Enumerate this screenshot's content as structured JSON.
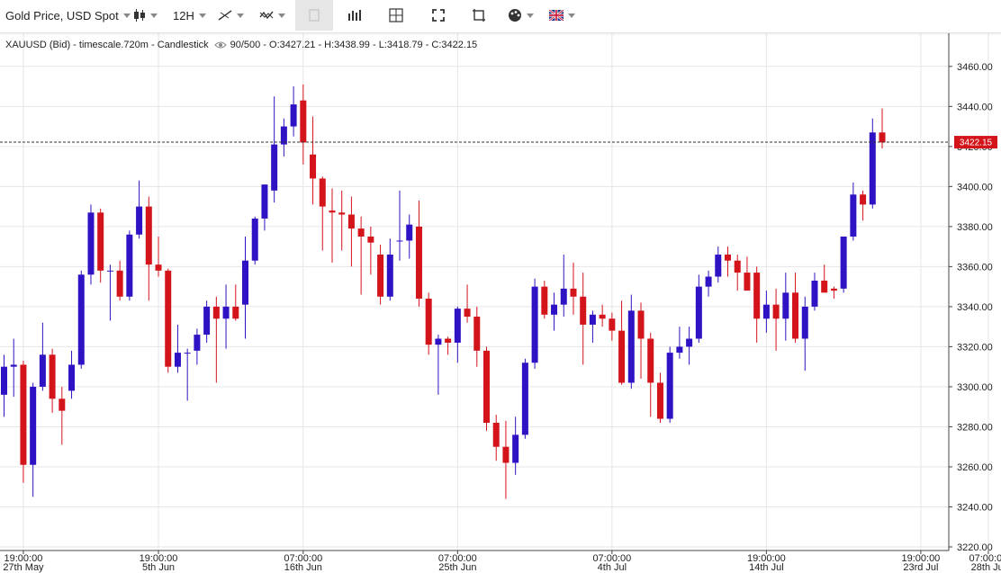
{
  "toolbar": {
    "symbol_label": "Gold Price, USD Spot",
    "timeframe_label": "12H"
  },
  "legend": {
    "series_title": "XAUUSD (Bid) - timescale.720m - Candlestick",
    "range": "90/500",
    "ohlc": "- O:3427.21 - H:3438.99 - L:3418.79 - C:3422.15"
  },
  "colors": {
    "up": "#2d13c4",
    "down": "#d4141b",
    "grid": "#e6e6e6",
    "price_tag": "#d4141b"
  },
  "chart_data": {
    "type": "candlestick",
    "ylim": [
      3220,
      3480
    ],
    "yticks": [
      3220,
      3240,
      3260,
      3280,
      3300,
      3320,
      3340,
      3360,
      3380,
      3400,
      3420,
      3440,
      3460,
      3480
    ],
    "last_price": 3422.15,
    "last_price_label": "3422.15",
    "x_ticks": [
      {
        "index": 2,
        "time": "19:00:00",
        "date": "27th May"
      },
      {
        "index": 16,
        "time": "19:00:00",
        "date": "5th Jun"
      },
      {
        "index": 31,
        "time": "07:00:00",
        "date": "16th Jun"
      },
      {
        "index": 47,
        "time": "07:00:00",
        "date": "25th Jun"
      },
      {
        "index": 63,
        "time": "07:00:00",
        "date": "4th Jul"
      },
      {
        "index": 79,
        "time": "19:00:00",
        "date": "14th Jul"
      },
      {
        "index": 95,
        "time": "19:00:00",
        "date": "23rd Jul"
      },
      {
        "index": 102,
        "time": "07:00:00",
        "date": "28th Jul"
      }
    ],
    "candles": [
      {
        "o": 3296,
        "h": 3316,
        "l": 3285,
        "c": 3310
      },
      {
        "o": 3310,
        "h": 3324,
        "l": 3295,
        "c": 3311
      },
      {
        "o": 3311,
        "h": 3313,
        "l": 3252,
        "c": 3261
      },
      {
        "o": 3261,
        "h": 3302,
        "l": 3245,
        "c": 3300
      },
      {
        "o": 3300,
        "h": 3332,
        "l": 3298,
        "c": 3316
      },
      {
        "o": 3316,
        "h": 3319,
        "l": 3287,
        "c": 3294
      },
      {
        "o": 3294,
        "h": 3300,
        "l": 3271,
        "c": 3288
      },
      {
        "o": 3298,
        "h": 3318,
        "l": 3294,
        "c": 3311
      },
      {
        "o": 3311,
        "h": 3358,
        "l": 3309,
        "c": 3356
      },
      {
        "o": 3356,
        "h": 3391,
        "l": 3351,
        "c": 3387
      },
      {
        "o": 3387,
        "h": 3389,
        "l": 3352,
        "c": 3358
      },
      {
        "o": 3358,
        "h": 3361,
        "l": 3333,
        "c": 3358
      },
      {
        "o": 3358,
        "h": 3363,
        "l": 3343,
        "c": 3345
      },
      {
        "o": 3345,
        "h": 3378,
        "l": 3343,
        "c": 3376
      },
      {
        "o": 3376,
        "h": 3403,
        "l": 3374,
        "c": 3390
      },
      {
        "o": 3390,
        "h": 3395,
        "l": 3343,
        "c": 3361
      },
      {
        "o": 3361,
        "h": 3375,
        "l": 3355,
        "c": 3358
      },
      {
        "o": 3358,
        "h": 3359,
        "l": 3307,
        "c": 3310
      },
      {
        "o": 3310,
        "h": 3331,
        "l": 3307,
        "c": 3317
      },
      {
        "o": 3317,
        "h": 3319,
        "l": 3293,
        "c": 3317
      },
      {
        "o": 3318,
        "h": 3329,
        "l": 3311,
        "c": 3326
      },
      {
        "o": 3326,
        "h": 3343,
        "l": 3322,
        "c": 3340
      },
      {
        "o": 3340,
        "h": 3345,
        "l": 3302,
        "c": 3334
      },
      {
        "o": 3334,
        "h": 3351,
        "l": 3319,
        "c": 3340
      },
      {
        "o": 3340,
        "h": 3351,
        "l": 3333,
        "c": 3334
      },
      {
        "o": 3341,
        "h": 3375,
        "l": 3324,
        "c": 3363
      },
      {
        "o": 3363,
        "h": 3385,
        "l": 3361,
        "c": 3384
      },
      {
        "o": 3384,
        "h": 3399,
        "l": 3378,
        "c": 3401
      },
      {
        "o": 3398,
        "h": 3445,
        "l": 3392,
        "c": 3421
      },
      {
        "o": 3421,
        "h": 3434,
        "l": 3415,
        "c": 3430
      },
      {
        "o": 3430,
        "h": 3450,
        "l": 3425,
        "c": 3441
      },
      {
        "o": 3443,
        "h": 3451,
        "l": 3411,
        "c": 3422
      },
      {
        "o": 3416,
        "h": 3435,
        "l": 3391,
        "c": 3404
      },
      {
        "o": 3404,
        "h": 3405,
        "l": 3368,
        "c": 3390
      },
      {
        "o": 3388,
        "h": 3399,
        "l": 3362,
        "c": 3387
      },
      {
        "o": 3387,
        "h": 3398,
        "l": 3368,
        "c": 3386
      },
      {
        "o": 3386,
        "h": 3395,
        "l": 3360,
        "c": 3379
      },
      {
        "o": 3379,
        "h": 3385,
        "l": 3346,
        "c": 3375
      },
      {
        "o": 3375,
        "h": 3380,
        "l": 3356,
        "c": 3372
      },
      {
        "o": 3366,
        "h": 3371,
        "l": 3341,
        "c": 3345
      },
      {
        "o": 3345,
        "h": 3374,
        "l": 3343,
        "c": 3366
      },
      {
        "o": 3373,
        "h": 3398,
        "l": 3363,
        "c": 3373
      },
      {
        "o": 3373,
        "h": 3386,
        "l": 3364,
        "c": 3381
      },
      {
        "o": 3380,
        "h": 3393,
        "l": 3340,
        "c": 3344
      },
      {
        "o": 3344,
        "h": 3347,
        "l": 3316,
        "c": 3321
      },
      {
        "o": 3321,
        "h": 3326,
        "l": 3296,
        "c": 3324
      },
      {
        "o": 3324,
        "h": 3325,
        "l": 3316,
        "c": 3322
      },
      {
        "o": 3322,
        "h": 3340,
        "l": 3312,
        "c": 3339
      },
      {
        "o": 3339,
        "h": 3351,
        "l": 3332,
        "c": 3335
      },
      {
        "o": 3335,
        "h": 3340,
        "l": 3310,
        "c": 3318
      },
      {
        "o": 3318,
        "h": 3320,
        "l": 3278,
        "c": 3282
      },
      {
        "o": 3282,
        "h": 3286,
        "l": 3263,
        "c": 3270
      },
      {
        "o": 3270,
        "h": 3283,
        "l": 3244,
        "c": 3262
      },
      {
        "o": 3262,
        "h": 3285,
        "l": 3256,
        "c": 3276
      },
      {
        "o": 3276,
        "h": 3314,
        "l": 3274,
        "c": 3312
      },
      {
        "o": 3312,
        "h": 3354,
        "l": 3309,
        "c": 3350
      },
      {
        "o": 3350,
        "h": 3353,
        "l": 3334,
        "c": 3336
      },
      {
        "o": 3336,
        "h": 3347,
        "l": 3328,
        "c": 3341
      },
      {
        "o": 3341,
        "h": 3366,
        "l": 3335,
        "c": 3349
      },
      {
        "o": 3349,
        "h": 3362,
        "l": 3336,
        "c": 3345
      },
      {
        "o": 3345,
        "h": 3357,
        "l": 3311,
        "c": 3331
      },
      {
        "o": 3331,
        "h": 3338,
        "l": 3322,
        "c": 3336
      },
      {
        "o": 3336,
        "h": 3341,
        "l": 3330,
        "c": 3334
      },
      {
        "o": 3334,
        "h": 3337,
        "l": 3323,
        "c": 3328
      },
      {
        "o": 3328,
        "h": 3343,
        "l": 3301,
        "c": 3302
      },
      {
        "o": 3302,
        "h": 3346,
        "l": 3299,
        "c": 3338
      },
      {
        "o": 3338,
        "h": 3342,
        "l": 3304,
        "c": 3324
      },
      {
        "o": 3324,
        "h": 3327,
        "l": 3285,
        "c": 3302
      },
      {
        "o": 3302,
        "h": 3307,
        "l": 3282,
        "c": 3284
      },
      {
        "o": 3284,
        "h": 3320,
        "l": 3282,
        "c": 3317
      },
      {
        "o": 3317,
        "h": 3330,
        "l": 3314,
        "c": 3320
      },
      {
        "o": 3320,
        "h": 3330,
        "l": 3311,
        "c": 3324
      },
      {
        "o": 3324,
        "h": 3356,
        "l": 3322,
        "c": 3350
      },
      {
        "o": 3350,
        "h": 3358,
        "l": 3345,
        "c": 3355
      },
      {
        "o": 3355,
        "h": 3370,
        "l": 3352,
        "c": 3366
      },
      {
        "o": 3366,
        "h": 3370,
        "l": 3355,
        "c": 3363
      },
      {
        "o": 3363,
        "h": 3366,
        "l": 3348,
        "c": 3357
      },
      {
        "o": 3357,
        "h": 3365,
        "l": 3349,
        "c": 3348
      },
      {
        "o": 3357,
        "h": 3360,
        "l": 3322,
        "c": 3334
      },
      {
        "o": 3334,
        "h": 3348,
        "l": 3327,
        "c": 3341
      },
      {
        "o": 3341,
        "h": 3349,
        "l": 3318,
        "c": 3334
      },
      {
        "o": 3334,
        "h": 3357,
        "l": 3323,
        "c": 3347
      },
      {
        "o": 3347,
        "h": 3357,
        "l": 3322,
        "c": 3324
      },
      {
        "o": 3324,
        "h": 3345,
        "l": 3308,
        "c": 3340
      },
      {
        "o": 3340,
        "h": 3357,
        "l": 3338,
        "c": 3353
      },
      {
        "o": 3353,
        "h": 3361,
        "l": 3347,
        "c": 3347
      },
      {
        "o": 3349,
        "h": 3350,
        "l": 3344,
        "c": 3348
      },
      {
        "o": 3349,
        "h": 3375,
        "l": 3347,
        "c": 3375
      },
      {
        "o": 3375,
        "h": 3402,
        "l": 3373,
        "c": 3396
      },
      {
        "o": 3396,
        "h": 3398,
        "l": 3383,
        "c": 3391
      },
      {
        "o": 3391,
        "h": 3434,
        "l": 3389,
        "c": 3427
      },
      {
        "o": 3427,
        "h": 3439,
        "l": 3419,
        "c": 3422
      }
    ]
  }
}
